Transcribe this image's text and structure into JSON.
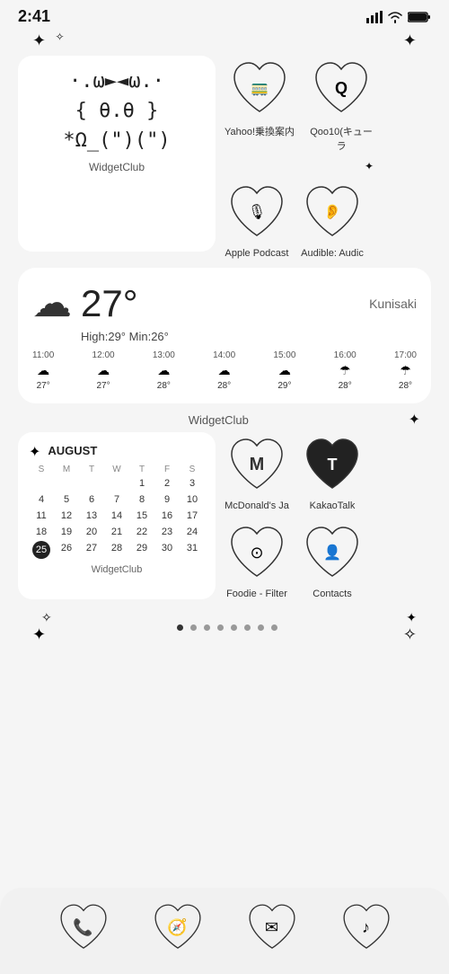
{
  "statusBar": {
    "time": "2:41",
    "signal": "▲▲▲",
    "wifi": "wifi",
    "battery": "battery"
  },
  "sparkles": {
    "topLeft1": "✦",
    "topLeft2": "✧",
    "topRight1": "✦"
  },
  "widgetClub": {
    "label": "WidgetClub",
    "charLine1": "·.ω►◄ω.·",
    "charLine2": "{ θ.θ }",
    "charLine3": "*Ω_(\")(\")"
  },
  "apps": {
    "yahoo": {
      "label": "Yahoo!乗換案内",
      "symbol": "🚃"
    },
    "qoo10": {
      "label": "Qoo10(キューラ",
      "symbol": "Q"
    },
    "applePodcast": {
      "label": "Apple Podcast",
      "symbol": "🎙"
    },
    "audible": {
      "label": "Audible: Audic",
      "symbol": "👂"
    }
  },
  "weather": {
    "location": "Kunisaki",
    "temp": "27°",
    "high": "High:29°",
    "min": "Min:26°",
    "hours": [
      {
        "time": "11:00",
        "icon": "☁",
        "temp": "27°"
      },
      {
        "time": "12:00",
        "icon": "☁",
        "temp": "27°"
      },
      {
        "time": "13:00",
        "icon": "☁",
        "temp": "28°"
      },
      {
        "time": "14:00",
        "icon": "☁",
        "temp": "28°"
      },
      {
        "time": "15:00",
        "icon": "☁",
        "temp": "29°"
      },
      {
        "time": "16:00",
        "icon": "☂",
        "temp": "28°"
      },
      {
        "time": "17:00",
        "icon": "☂",
        "temp": "28°"
      }
    ]
  },
  "widgetClub2": {
    "label": "WidgetClub"
  },
  "calendar": {
    "month": "AUGUST",
    "dayHeaders": [
      "S",
      "M",
      "T",
      "W",
      "T",
      "F",
      "S"
    ],
    "label": "WidgetClub",
    "rows": [
      [
        "",
        "",
        "",
        "",
        "1",
        "2",
        "3"
      ],
      [
        "4",
        "5",
        "6",
        "7",
        "8",
        "9",
        "10"
      ],
      [
        "11",
        "12",
        "13",
        "14",
        "15",
        "16",
        "17"
      ],
      [
        "18",
        "19",
        "20",
        "21",
        "22",
        "23",
        "24"
      ],
      [
        "25",
        "26",
        "27",
        "28",
        "29",
        "30",
        "31"
      ]
    ],
    "today": "25"
  },
  "apps2": {
    "mcdonalds": {
      "label": "McDonald's Ja",
      "symbol": "M"
    },
    "kakaoTalk": {
      "label": "KakaoTalk",
      "symbol": "T"
    },
    "foodie": {
      "label": "Foodie - Filter",
      "symbol": "⊙"
    },
    "contacts": {
      "label": "Contacts",
      "symbol": "👤"
    }
  },
  "pageDots": {
    "count": 8,
    "active": 0
  },
  "dock": {
    "phone": "phone",
    "compass": "compass",
    "mail": "mail",
    "music": "music"
  },
  "bottomSparkles": {
    "left1": "✧",
    "left2": "✦",
    "right1": "✦",
    "right2": "✧"
  }
}
